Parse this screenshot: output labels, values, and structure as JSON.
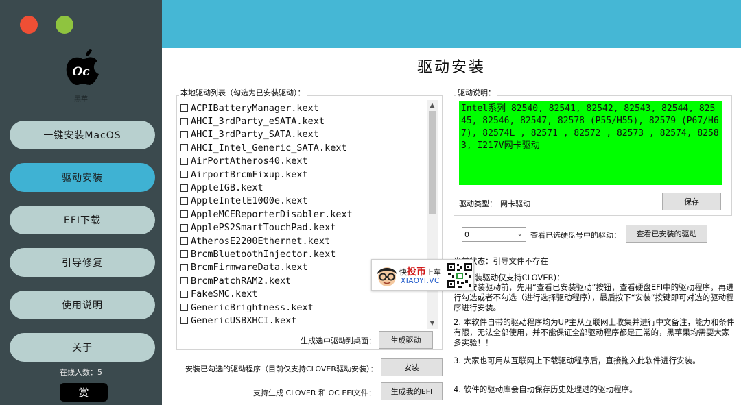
{
  "sidebar": {
    "logo_text": "Oc",
    "logo_caption": "黑苹",
    "items": [
      {
        "label": "一键安装MacOS",
        "active": false
      },
      {
        "label": "驱动安装",
        "active": true
      },
      {
        "label": "EFI下载",
        "active": false
      },
      {
        "label": "引导修复",
        "active": false
      },
      {
        "label": "使用说明",
        "active": false
      },
      {
        "label": "关于",
        "active": false
      }
    ],
    "online_count": "在线人数：5",
    "reward_label": "赏"
  },
  "colors": {
    "sidebar_bg": "#3b4a4e",
    "banner": "#45b7d5",
    "active_item": "#3fb2d3",
    "inactive_item": "#b8d0cf",
    "desc_bg": "#00ff00",
    "close": "#ef4f35",
    "minimize": "#8fc43f"
  },
  "main": {
    "title": "驱动安装",
    "list_group_label": "本地驱动列表（勾选为已安装驱动）：",
    "drivers": [
      "ACPIBatteryManager.kext",
      "AHCI_3rdParty_eSATA.kext",
      "AHCI_3rdParty_SATA.kext",
      "AHCI_Intel_Generic_SATA.kext",
      "AirPortAtheros40.kext",
      "AirportBrcmFixup.kext",
      "AppleIGB.kext",
      "AppleIntelE1000e.kext",
      "AppleMCEReporterDisabler.kext",
      "ApplePS2SmartTouchPad.kext",
      "AtherosE2200Ethernet.kext",
      "BrcmBluetoothInjector.kext",
      "BrcmFirmwareData.kext",
      "BrcmPatchRAM2.kext",
      "FakeSMC.kext",
      "GenericBrightness.kext",
      "GenericUSBXHCI.kext"
    ],
    "generate_desktop_label": "生成选中驱动到桌面：",
    "generate_button": "生成驱动",
    "desc_group_label": "驱动说明：",
    "description": "Intel系列 82540, 82541, 82542, 82543, 82544, 82545, 82546, 82547, 82578 (P55/H55), 82579 (P67/H67), 82574L , 82571 , 82572 , 82573 , 82574, 82583, I217V网卡驱动",
    "driver_type_label": "驱动类型：",
    "driver_type_value": "网卡驱动",
    "save_button": "保存",
    "disk_select_value": "0",
    "view_disk_label": "查看已选硬盘号中的驱动：",
    "view_installed_button": "查看已安装的驱动",
    "install_checked_label": "安装已勾选的驱动程序（目前仅支持CLOVER驱动安装）：",
    "install_button": "安装",
    "support_efi_label": "支持生成 CLOVER 和 OC EFI文件：",
    "generate_efi_button": "生成我的EFI",
    "status_line": "当前状态：引导文件不存在",
    "notes_heading": "1. (安装驱动仅支持CLOVER)：",
    "notes": [
      "如需安装驱动前，先用“查看已安装驱动”按钮，查看硬盘EFI中的驱动程序，再进行勾选或者不勾选（进行选择驱动程序），最后按下“安装”按键即可对选的驱动程序进行安装。",
      "2. 本软件自带的驱动程序均为UP主从互联网上收集并进行中文备注，能力和条件有限，无法全部使用，并不能保证全部驱动程序都是正常的，黑苹果均需要大家多实验！！",
      "3. 大家也可用从互联网上下载驱动程序后，直接拖入此软件进行安装。",
      "4. 软件的驱动库会自动保存历史处理过的驱动程序。"
    ]
  },
  "watermark": {
    "line1_prefix": "快",
    "line1_brand": "投币",
    "line1_suffix": "上车",
    "line2": "XIAOYI.VC"
  }
}
